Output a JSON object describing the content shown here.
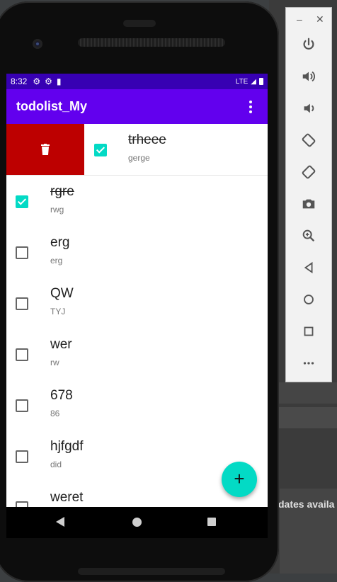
{
  "status_bar": {
    "time": "8:32",
    "network": "LTE"
  },
  "app_bar": {
    "title": "todolist_My"
  },
  "swiped_item": {
    "title": "trheee",
    "subtitle": "gerge",
    "checked": true
  },
  "items": [
    {
      "title": "rgre",
      "subtitle": "rwg",
      "checked": true
    },
    {
      "title": "erg",
      "subtitle": "erg",
      "checked": false
    },
    {
      "title": "QW",
      "subtitle": "TYJ",
      "checked": false
    },
    {
      "title": "wer",
      "subtitle": "rw",
      "checked": false
    },
    {
      "title": "678",
      "subtitle": "86",
      "checked": false
    },
    {
      "title": "hjfgdf",
      "subtitle": "did",
      "checked": false
    },
    {
      "title": "weret",
      "subtitle": "",
      "checked": false
    }
  ],
  "fab": {
    "label": "+"
  },
  "ide": {
    "notice": "dates availa"
  },
  "emulator": {
    "window_controls": [
      "minimize-icon",
      "close-icon"
    ],
    "buttons": [
      "power-icon",
      "volume-up-icon",
      "volume-down-icon",
      "rotate-left-icon",
      "rotate-right-icon",
      "camera-icon",
      "zoom-icon",
      "back-icon",
      "home-icon",
      "overview-icon",
      "more-icon"
    ]
  },
  "colors": {
    "status_bar": "#3700b3",
    "app_bar": "#6200ee",
    "accent": "#03dac5",
    "delete": "#bd0000"
  }
}
